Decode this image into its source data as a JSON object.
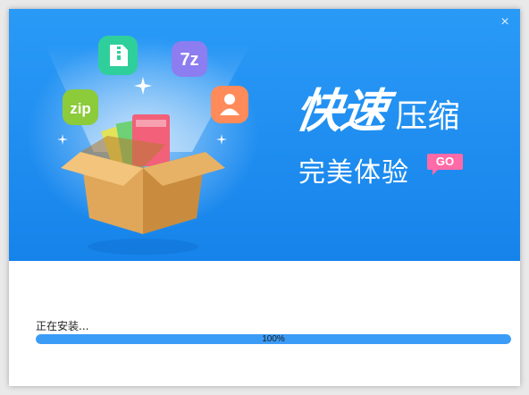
{
  "banner": {
    "headline_main": "快速",
    "headline_sub": "压缩",
    "tagline": "完美体验",
    "go_label": "GO",
    "close_label": "×",
    "icons": {
      "zip_label": "zip",
      "sevenz_label": "7z"
    },
    "colors": {
      "background": "#1f8ef2",
      "go_badge": "#ff6aa7"
    }
  },
  "install": {
    "status_text": "正在安装...",
    "progress_percent": 100,
    "progress_text": "100%"
  }
}
